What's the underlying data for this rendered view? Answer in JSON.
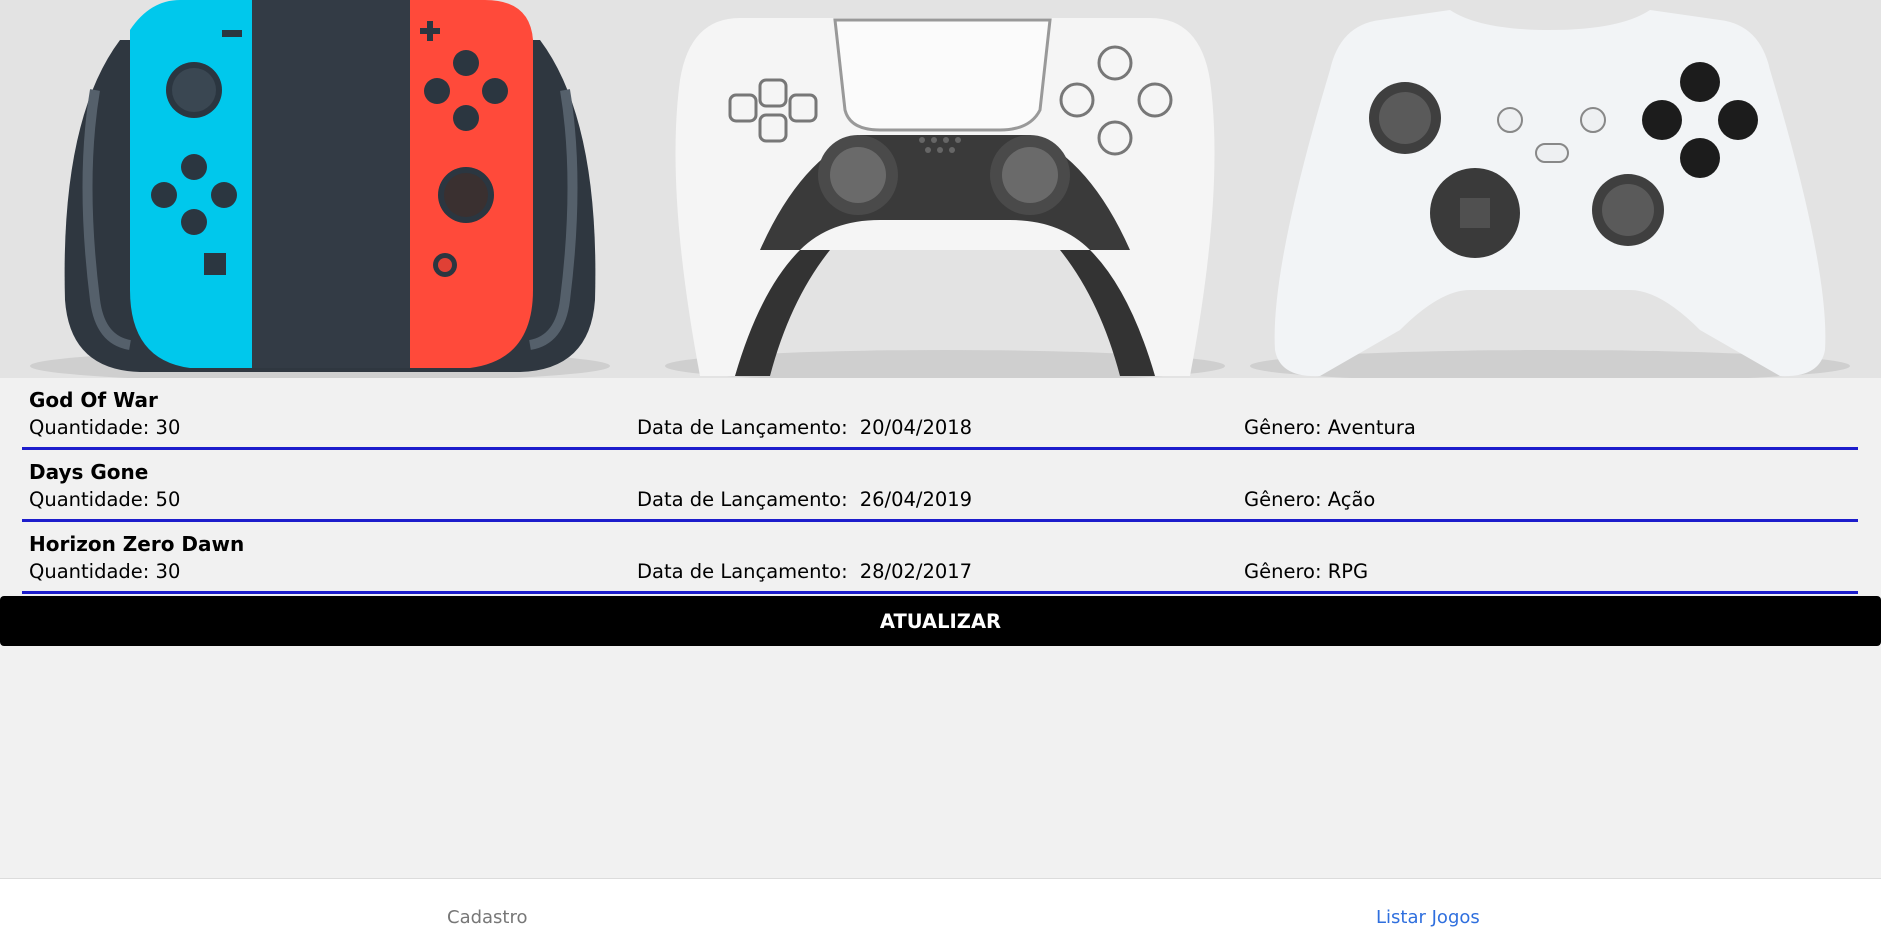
{
  "games": [
    {
      "name": "God Of War",
      "quantity_label": "Quantidade: 30",
      "date_label": "Data de Lançamento:",
      "date": "20/04/2018",
      "genre_label": "Gênero: Aventura"
    },
    {
      "name": "Days Gone",
      "quantity_label": "Quantidade: 50",
      "date_label": "Data de Lançamento:",
      "date": "26/04/2019",
      "genre_label": "Gênero: Ação"
    },
    {
      "name": "Horizon Zero Dawn",
      "quantity_label": "Quantidade: 30",
      "date_label": "Data de Lançamento:",
      "date": "28/02/2017",
      "genre_label": "Gênero: RPG"
    }
  ],
  "update_button": "ATUALIZAR",
  "nav": {
    "cadastro": "Cadastro",
    "listar": "Listar Jogos"
  },
  "colors": {
    "divider": "#1d1dcc",
    "active_tab": "#2f6fde",
    "joycon_left": "#00c8ec",
    "joycon_right": "#ff4a3a"
  },
  "icons": [
    "switch-controller-icon",
    "dualsense-controller-icon",
    "xbox-controller-icon"
  ]
}
